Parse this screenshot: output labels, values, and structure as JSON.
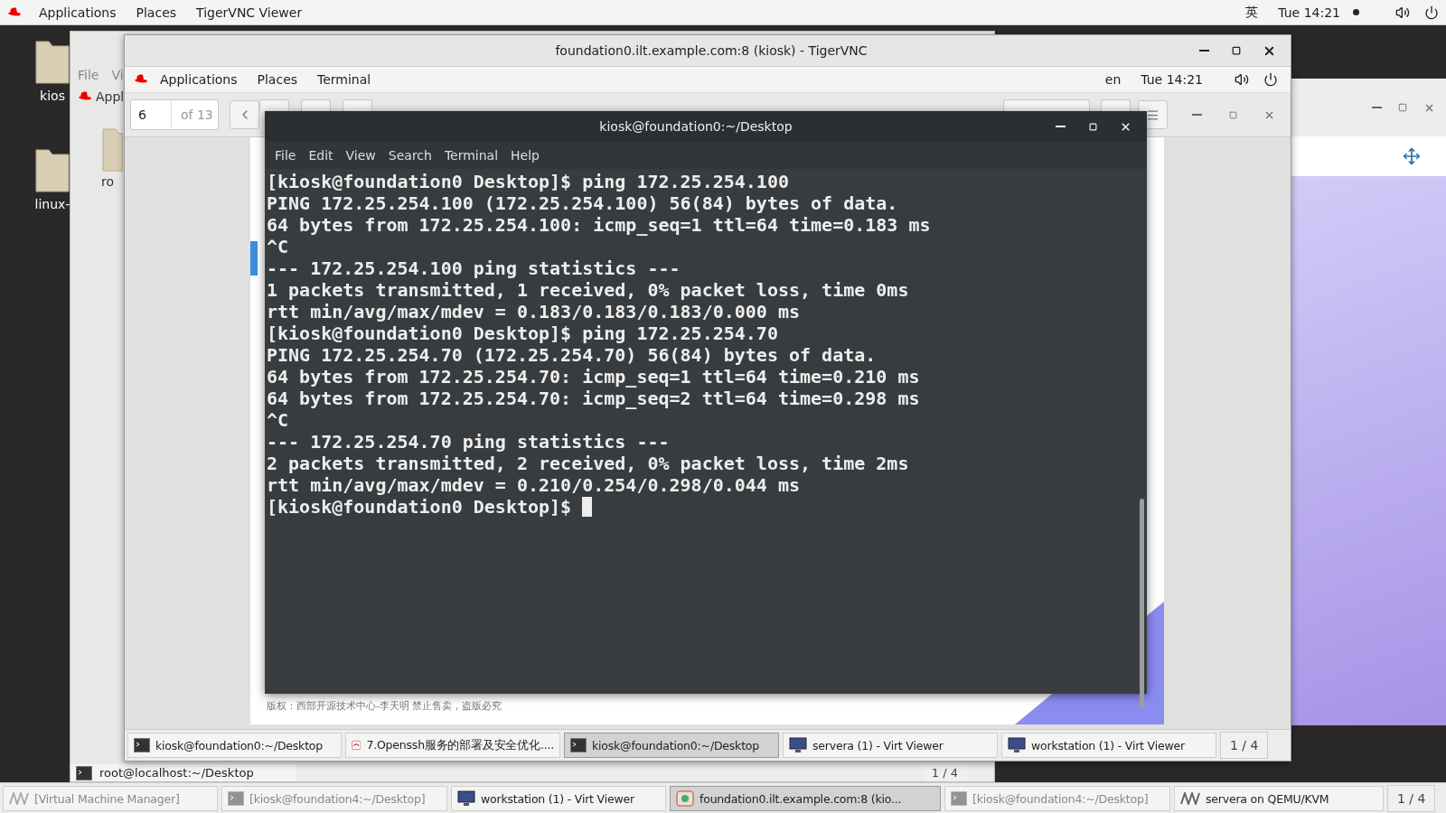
{
  "top_bar": {
    "menus": [
      "Applications",
      "Places",
      "TigerVNC Viewer"
    ],
    "input_method": "英",
    "clock": "Tue 14:21"
  },
  "desktop_icons": [
    {
      "label": "kios"
    },
    {
      "label": "linux-"
    }
  ],
  "back_window": {
    "menus": [
      "File",
      "Vi"
    ],
    "app_menu": "Appl",
    "icon_label": "ro",
    "taskbar": {
      "items": [
        {
          "label": "root@localhost:~/Desktop",
          "kind": "terminal",
          "selected": false
        }
      ],
      "pager": "1 / 4"
    }
  },
  "vnc_window": {
    "title": "foundation0.ilt.example.com:8 (kiosk) - TigerVNC",
    "panel": {
      "menus": [
        "Applications",
        "Places",
        "Terminal"
      ],
      "language": "en",
      "clock": "Tue 14:21"
    },
    "viewer": {
      "page": "6",
      "page_count": "of 13",
      "footer": "版权：西部开源技术中心-李天明  禁止售卖，盗版必究"
    },
    "terminal": {
      "title": "kiosk@foundation0:~/Desktop",
      "menus": [
        "File",
        "Edit",
        "View",
        "Search",
        "Terminal",
        "Help"
      ],
      "lines": [
        "[kiosk@foundation0 Desktop]$ ping 172.25.254.100",
        "PING 172.25.254.100 (172.25.254.100) 56(84) bytes of data.",
        "64 bytes from 172.25.254.100: icmp_seq=1 ttl=64 time=0.183 ms",
        "^C",
        "--- 172.25.254.100 ping statistics ---",
        "1 packets transmitted, 1 received, 0% packet loss, time 0ms",
        "rtt min/avg/max/mdev = 0.183/0.183/0.183/0.000 ms",
        "[kiosk@foundation0 Desktop]$ ping 172.25.254.70",
        "PING 172.25.254.70 (172.25.254.70) 56(84) bytes of data.",
        "64 bytes from 172.25.254.70: icmp_seq=1 ttl=64 time=0.210 ms",
        "64 bytes from 172.25.254.70: icmp_seq=2 ttl=64 time=0.298 ms",
        "^C",
        "--- 172.25.254.70 ping statistics ---",
        "2 packets transmitted, 2 received, 0% packet loss, time 2ms",
        "rtt min/avg/max/mdev = 0.210/0.254/0.298/0.044 ms",
        "[kiosk@foundation0 Desktop]$ "
      ]
    },
    "taskbar": {
      "items": [
        {
          "label": "kiosk@foundation0:~/Desktop",
          "kind": "terminal",
          "selected": false
        },
        {
          "label": "7.Openssh服务的部署及安全优化....",
          "kind": "document",
          "selected": false
        },
        {
          "label": "kiosk@foundation0:~/Desktop",
          "kind": "terminal",
          "selected": true
        },
        {
          "label": "servera (1) - Virt Viewer",
          "kind": "viewer",
          "selected": false
        },
        {
          "label": "workstation (1) - Virt Viewer",
          "kind": "viewer",
          "selected": false
        }
      ],
      "pager": "1 / 4"
    }
  },
  "taskbar": {
    "items": [
      {
        "label": "[Virtual Machine Manager]",
        "kind": "manager",
        "selected": false,
        "minimized": true
      },
      {
        "label": "[kiosk@foundation4:~/Desktop]",
        "kind": "terminal",
        "selected": false,
        "minimized": true
      },
      {
        "label": "workstation (1) - Virt Viewer",
        "kind": "viewer",
        "selected": false,
        "minimized": false
      },
      {
        "label": "foundation0.ilt.example.com:8 (kio...",
        "kind": "vnc",
        "selected": true,
        "minimized": false
      },
      {
        "label": "[kiosk@foundation4:~/Desktop]",
        "kind": "terminal",
        "selected": false,
        "minimized": true
      },
      {
        "label": "servera on QEMU/KVM",
        "kind": "manager",
        "selected": false,
        "minimized": false
      }
    ],
    "pager": "1 / 4"
  }
}
